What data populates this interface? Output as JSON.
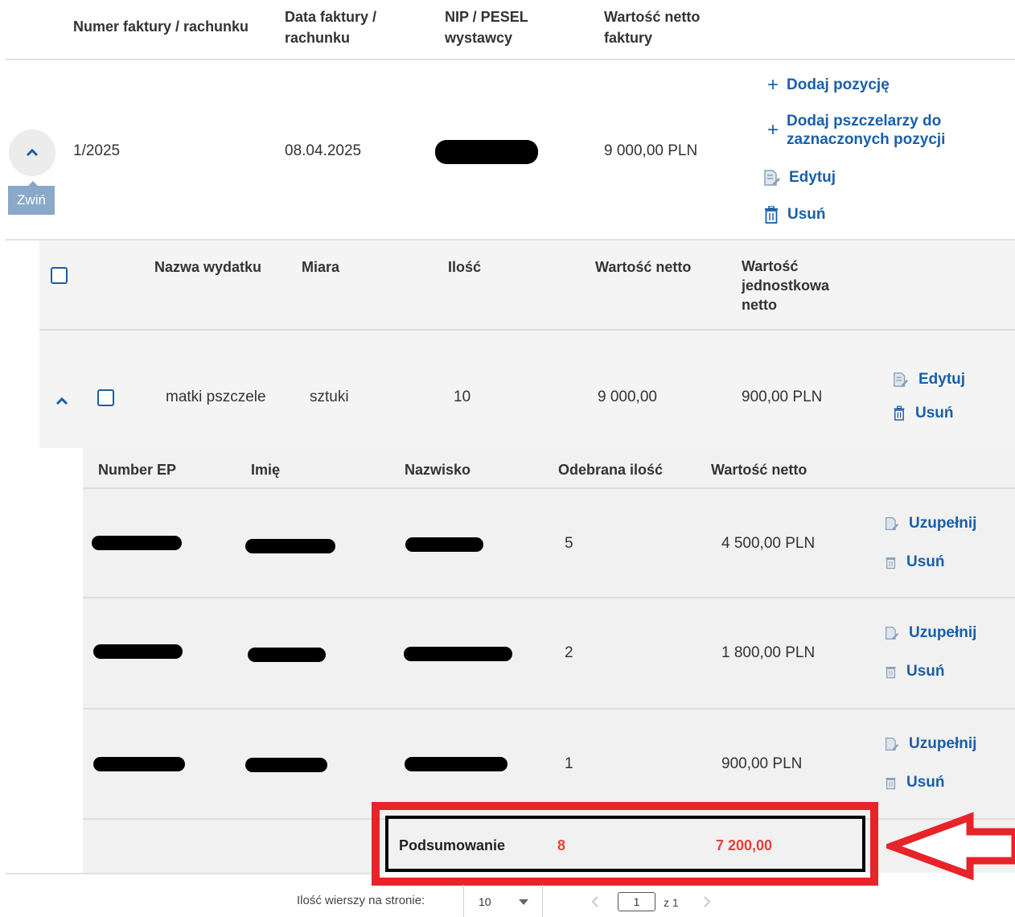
{
  "invoice_header": {
    "col_number": "Numer faktury / rachunku",
    "col_date_line1": "Data faktury /",
    "col_date_line2": "rachunku",
    "col_nip_line1": "NIP / PESEL",
    "col_nip_line2": "wystawcy",
    "col_value_line1": "Wartość netto",
    "col_value_line2": "faktury"
  },
  "invoice_row": {
    "number": "1/2025",
    "date": "08.04.2025",
    "value": "9 000,00 PLN",
    "collapse_tooltip": "Zwiń",
    "actions": {
      "add_position": "Dodaj pozycję",
      "add_beekeepers_line1": "Dodaj pszczelarzy do",
      "add_beekeepers_line2": "zaznaczonych pozycji",
      "edit": "Edytuj",
      "delete": "Usuń"
    }
  },
  "positions_header": {
    "col_name": "Nazwa wydatku",
    "col_measure": "Miara",
    "col_quantity": "Ilość",
    "col_net_value": "Wartość netto",
    "col_unit_line1": "Wartość",
    "col_unit_line2": "jednostkowa",
    "col_unit_line3": "netto"
  },
  "position_row": {
    "name": "matki pszczele",
    "measure": "sztuki",
    "quantity": "10",
    "net_value": "9 000,00",
    "unit_value": "900,00 PLN",
    "edit": "Edytuj",
    "delete": "Usuń"
  },
  "beekeepers_header": {
    "col_ep": "Number EP",
    "col_first": "Imię",
    "col_last": "Nazwisko",
    "col_received": "Odebrana ilość",
    "col_net": "Wartość netto"
  },
  "beekeepers": [
    {
      "received": "5",
      "net": "4 500,00 PLN",
      "complete": "Uzupełnij",
      "delete": "Usuń"
    },
    {
      "received": "2",
      "net": "1 800,00 PLN",
      "complete": "Uzupełnij",
      "delete": "Usuń"
    },
    {
      "received": "1",
      "net": "900,00 PLN",
      "complete": "Uzupełnij",
      "delete": "Usuń"
    }
  ],
  "summary": {
    "label": "Podsumowanie",
    "quantity": "8",
    "value": "7 200,00"
  },
  "pagination": {
    "rows_label": "Ilość wierszy na stronie:",
    "rows_value": "10",
    "page_value": "1",
    "page_of": "z 1"
  },
  "colors": {
    "accent": "#1a5fa8",
    "highlight_red": "#e8232a",
    "summary_red": "#e8403a"
  }
}
